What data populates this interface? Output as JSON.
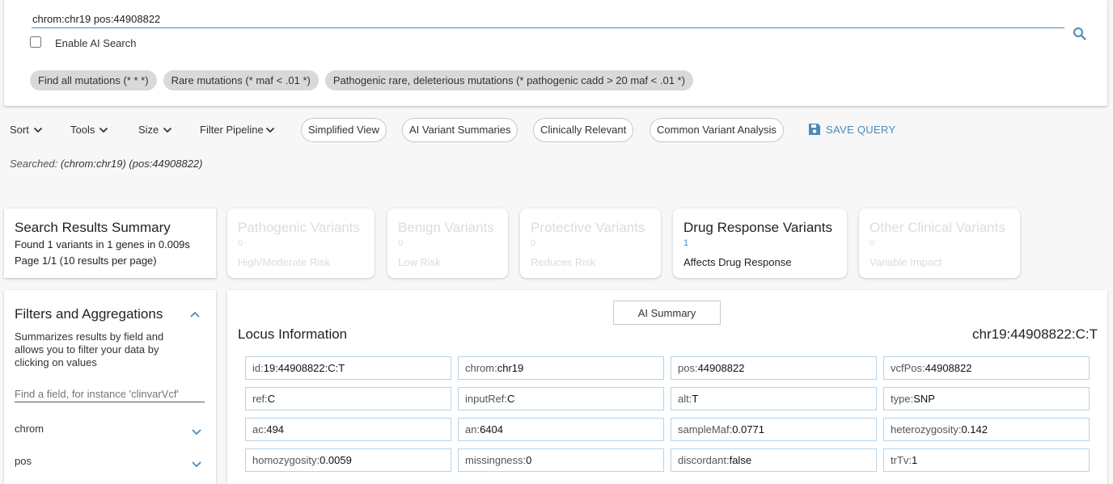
{
  "search": {
    "query": "chrom:chr19 pos:44908822",
    "ai_search_label": "Enable AI Search",
    "ai_search_checked": false
  },
  "chips": [
    "Find all mutations (* * *)",
    "Rare mutations (* maf < .01 *)",
    "Pathogenic rare, deleterious mutations (* pathogenic cadd > 20 maf < .01 *)"
  ],
  "toolbar": {
    "sort": "Sort",
    "tools": "Tools",
    "size": "Size",
    "filter_pipeline": "Filter Pipeline",
    "simplified_view": "Simplified View",
    "ai_variant_summaries": "AI Variant Summaries",
    "clinically_relevant": "Clinically Relevant",
    "common_variant_analysis": "Common Variant Analysis",
    "save_query": "SAVE QUERY"
  },
  "searched": {
    "label": "Searched:",
    "terms": "(chrom:chr19) (pos:44908822)"
  },
  "summary": {
    "title": "Search Results Summary",
    "found_prefix": "Found",
    "variants": "1",
    "variants_label": "variants in",
    "genes": "1",
    "genes_label": "genes in",
    "time": "0.009s",
    "page_line": "Page 1/1 (10 results per page)"
  },
  "categories": [
    {
      "title": "Pathogenic Variants",
      "count": "0",
      "subtitle": "High/Moderate Risk",
      "active": false
    },
    {
      "title": "Benign Variants",
      "count": "0",
      "subtitle": "Low Risk",
      "active": false
    },
    {
      "title": "Protective Variants",
      "count": "0",
      "subtitle": "Reduces Risk",
      "active": false
    },
    {
      "title": "Drug Response Variants",
      "count": "1",
      "subtitle": "Affects Drug Response",
      "active": true
    },
    {
      "title": "Other Clinical Variants",
      "count": "0",
      "subtitle": "Variable Impact",
      "active": false
    }
  ],
  "filters": {
    "title": "Filters and Aggregations",
    "description": "Summarizes results by field and allows you to filter your data by clicking on values",
    "placeholder": "Find a field, for instance 'clinvarVcf'",
    "fields": [
      "chrom",
      "pos"
    ]
  },
  "locus": {
    "ai_summary_label": "AI Summary",
    "title": "Locus Information",
    "variant_id": "chr19:44908822:C:T",
    "fields": [
      {
        "key": "id:",
        "value": "19:44908822:C:T"
      },
      {
        "key": "chrom:",
        "value": "chr19"
      },
      {
        "key": "pos:",
        "value": "44908822"
      },
      {
        "key": "vcfPos:",
        "value": "44908822"
      },
      {
        "key": "ref:",
        "value": "C"
      },
      {
        "key": "inputRef:",
        "value": "C"
      },
      {
        "key": "alt:",
        "value": "T"
      },
      {
        "key": "type:",
        "value": "SNP"
      },
      {
        "key": "ac:",
        "value": "494"
      },
      {
        "key": "an:",
        "value": "6404"
      },
      {
        "key": "sampleMaf:",
        "value": "0.0771"
      },
      {
        "key": "heterozygosity:",
        "value": "0.142"
      },
      {
        "key": "homozygosity:",
        "value": "0.0059"
      },
      {
        "key": "missingness:",
        "value": "0"
      },
      {
        "key": "discordant:",
        "value": "false"
      },
      {
        "key": "trTv:",
        "value": "1"
      }
    ]
  },
  "colors": {
    "accent": "#4a8ab8",
    "chip_bg": "#d9d9d9",
    "cell_border": "#b8d3e6",
    "disabled_text": "#dcdcdc"
  }
}
